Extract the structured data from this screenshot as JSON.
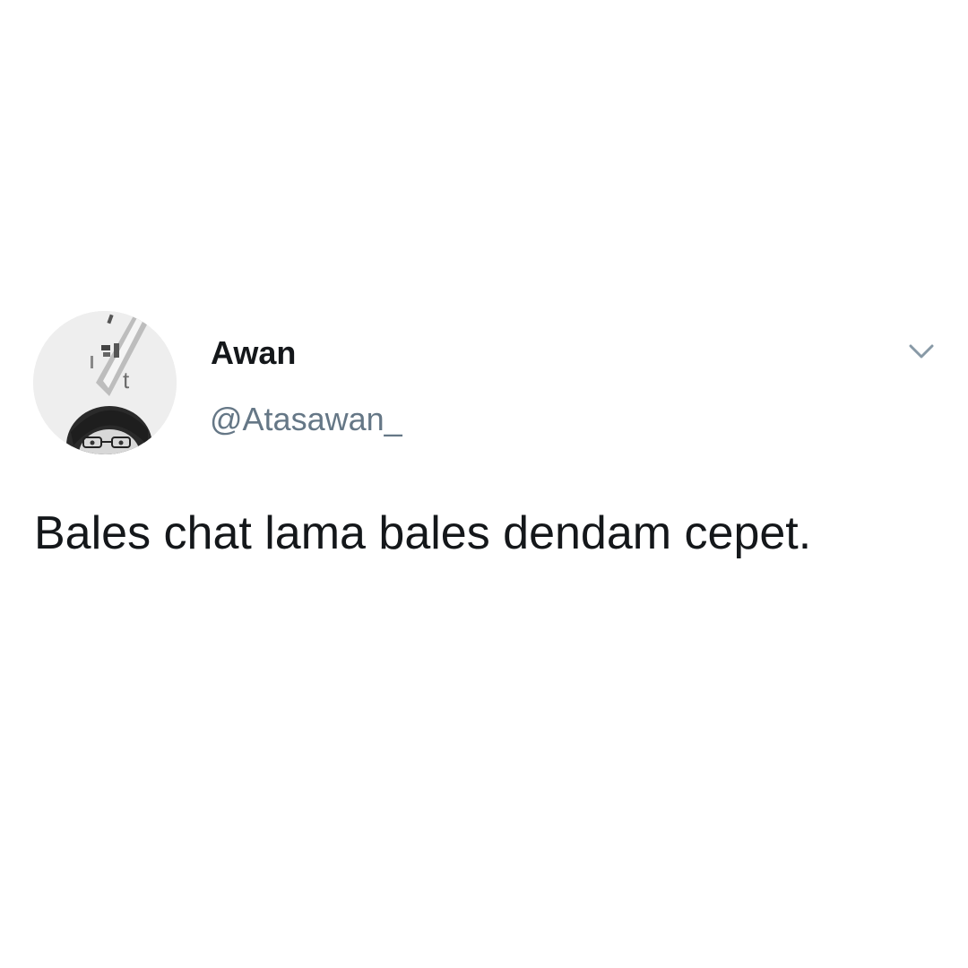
{
  "tweet": {
    "author": {
      "display_name": "Awan",
      "handle": "@Atasawan_",
      "avatar_letter": "t"
    },
    "text": "Bales chat lama bales dendam cepet.",
    "menu_icon": "chevron-down-icon"
  }
}
